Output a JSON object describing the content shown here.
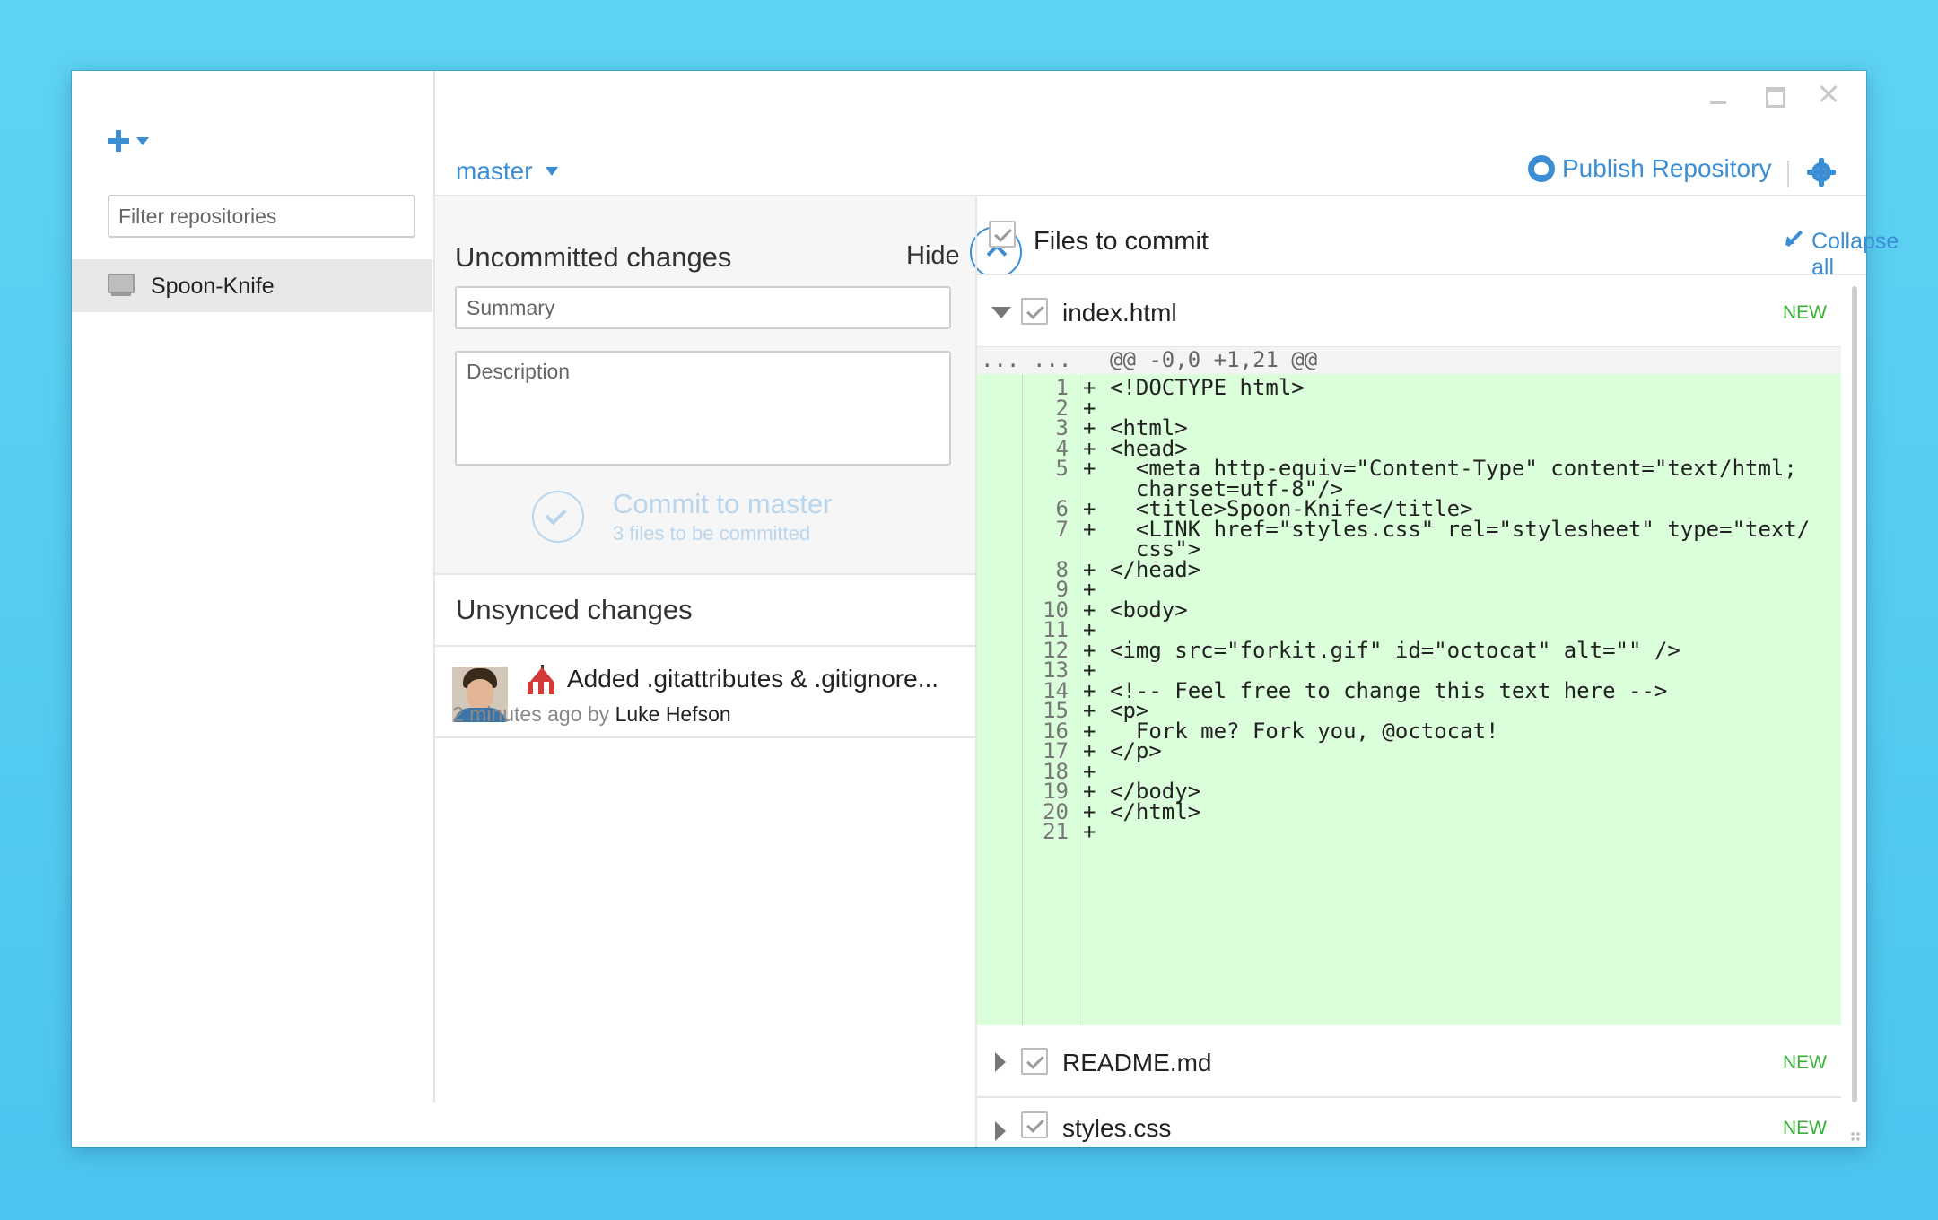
{
  "window": {
    "controls": [
      "minimize",
      "maximize",
      "close"
    ]
  },
  "sidebar": {
    "add_icon": "plus-icon",
    "filter_placeholder": "Filter repositories",
    "repositories": [
      {
        "name": "Spoon-Knife",
        "icon": "computer-icon",
        "selected": true
      }
    ]
  },
  "header": {
    "branch": "master",
    "publish_label": "Publish Repository",
    "settings_icon": "gear-icon"
  },
  "uncommitted": {
    "title": "Uncommitted changes",
    "hide_label": "Hide",
    "summary_placeholder": "Summary",
    "description_placeholder": "Description",
    "commit_label": "Commit to master",
    "commit_sub": "3 files to be committed"
  },
  "unsynced": {
    "title": "Unsynced changes",
    "commits": [
      {
        "message": "Added .gitattributes & .gitignore...",
        "time": "2 minutes ago",
        "by": "by",
        "author": "Luke Hefson",
        "emoji": "circus-tent-icon"
      }
    ]
  },
  "files": {
    "title": "Files to commit",
    "collapse_label": "Collapse all",
    "items": [
      {
        "name": "index.html",
        "status": "NEW",
        "expanded": true
      },
      {
        "name": "README.md",
        "status": "NEW",
        "expanded": false
      },
      {
        "name": "styles.css",
        "status": "NEW",
        "expanded": false
      }
    ]
  },
  "diff": {
    "hunk_gutter1": "...",
    "hunk_gutter2": "...",
    "hunk_header": "@@ -0,0 +1,21 @@",
    "lines": [
      {
        "num": "1",
        "code": "<!DOCTYPE html>"
      },
      {
        "num": "2",
        "code": ""
      },
      {
        "num": "3",
        "code": "<html>"
      },
      {
        "num": "4",
        "code": "<head>"
      },
      {
        "num": "5",
        "code": "  <meta http-equiv=\"Content-Type\" content=\"text/html;"
      },
      {
        "num": "",
        "code": "  charset=utf-8\"/>",
        "continuation": true
      },
      {
        "num": "6",
        "code": "  <title>Spoon-Knife</title>"
      },
      {
        "num": "7",
        "code": "  <LINK href=\"styles.css\" rel=\"stylesheet\" type=\"text/"
      },
      {
        "num": "",
        "code": "  css\">",
        "continuation": true
      },
      {
        "num": "8",
        "code": "</head>"
      },
      {
        "num": "9",
        "code": ""
      },
      {
        "num": "10",
        "code": "<body>"
      },
      {
        "num": "11",
        "code": ""
      },
      {
        "num": "12",
        "code": "<img src=\"forkit.gif\" id=\"octocat\" alt=\"\" />"
      },
      {
        "num": "13",
        "code": ""
      },
      {
        "num": "14",
        "code": "<!-- Feel free to change this text here -->"
      },
      {
        "num": "15",
        "code": "<p>"
      },
      {
        "num": "16",
        "code": "  Fork me? Fork you, @octocat!"
      },
      {
        "num": "17",
        "code": "</p>"
      },
      {
        "num": "18",
        "code": ""
      },
      {
        "num": "19",
        "code": "</body>"
      },
      {
        "num": "20",
        "code": "</html>"
      },
      {
        "num": "21",
        "code": ""
      }
    ]
  },
  "colors": {
    "accent": "#3b8ed3",
    "added_bg": "#dbffdb",
    "new_badge": "#3bb03b",
    "desktop_bg": "#4cc4ef"
  }
}
